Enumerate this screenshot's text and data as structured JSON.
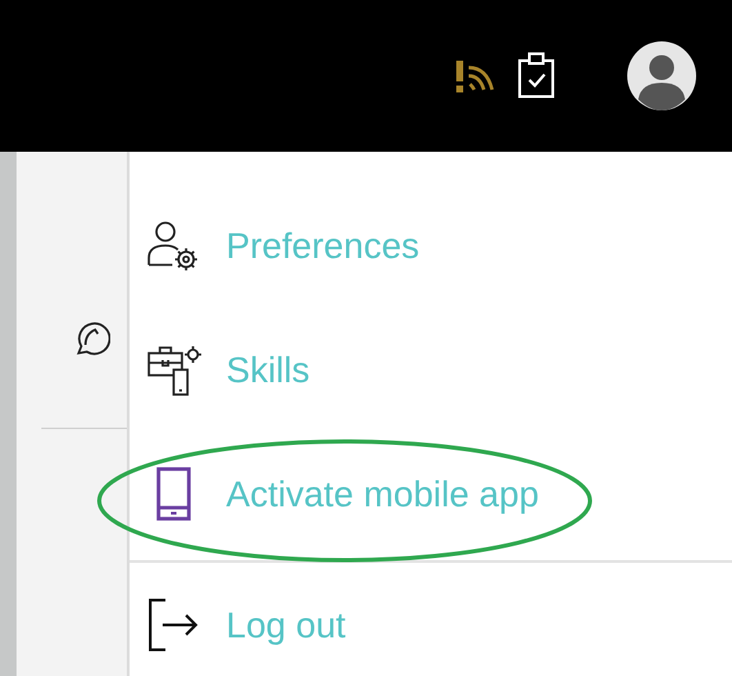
{
  "user_menu": {
    "items": [
      {
        "label": "Preferences",
        "circled": false
      },
      {
        "label": "Skills",
        "circled": false
      },
      {
        "label": "Activate mobile app",
        "circled": true
      }
    ],
    "footer_items": [
      {
        "label": "Log out",
        "circled": false
      }
    ]
  }
}
